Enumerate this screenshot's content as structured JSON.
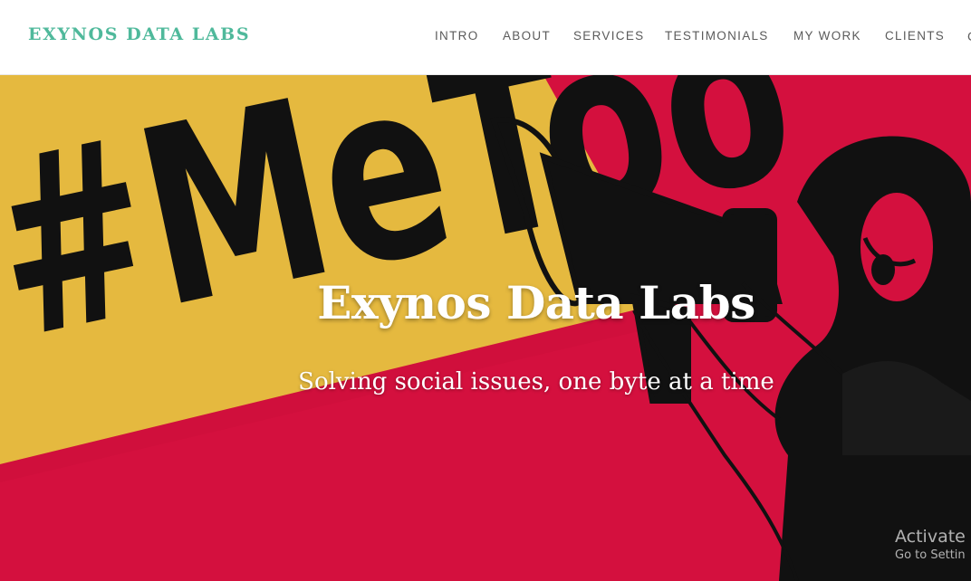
{
  "header": {
    "brand": "EXYNOS DATA LABS",
    "nav": [
      "INTRO",
      "ABOUT",
      "SERVICES",
      "TESTIMONIALS",
      "MY WORK",
      "CLIENTS"
    ],
    "nav_overflow_glyph": "C"
  },
  "hero": {
    "title": "Exynos Data Labs",
    "subtitle": "Solving social issues, one byte at a time",
    "image_text": "#MeToo"
  },
  "watermark": {
    "line1": "Activate W",
    "line2": "Go to Settin"
  },
  "colors": {
    "brand": "#4fb99b",
    "hero_red": "#d4103e",
    "megaphone_yellow": "#e5b93f",
    "ink": "#111111"
  }
}
